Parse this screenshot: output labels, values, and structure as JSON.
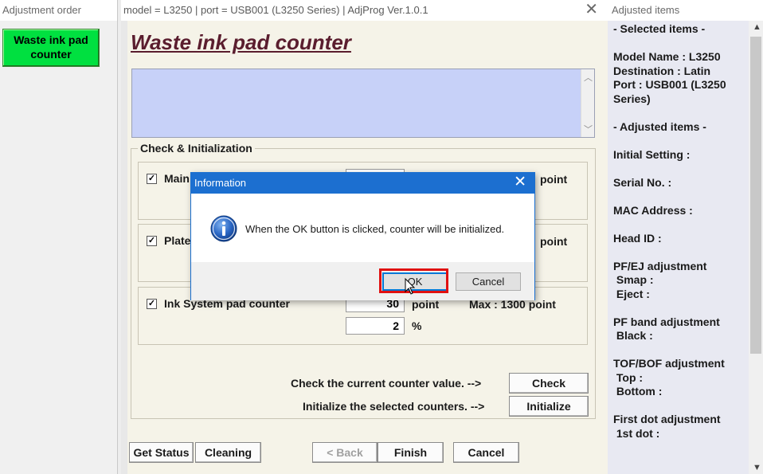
{
  "left_panel": {
    "title": "Adjustment order",
    "active_item": {
      "line1": "Waste ink pad",
      "line2": "counter",
      "color": "#00e040"
    }
  },
  "main_window": {
    "title": "model = L3250 | port = USB001 (L3250 Series) | AdjProg Ver.1.0.1",
    "heading": "Waste ink pad counter",
    "info_text": "",
    "group_title": "Check & Initialization",
    "counters": [
      {
        "checked": true,
        "name": "Main",
        "value": "",
        "unit": "point",
        "max": ""
      },
      {
        "checked": true,
        "name": "Plate",
        "value": "",
        "unit": "point",
        "max": ""
      },
      {
        "checked": true,
        "name": "Ink System pad counter",
        "value": "30",
        "unit": "point",
        "max": "Max : 1300 point",
        "percent": "2",
        "percent_unit": "%"
      }
    ],
    "check_hint": "Check the current counter value. -->",
    "check_button": "Check",
    "init_hint": "Initialize the selected counters. -->",
    "init_button": "Initialize",
    "footer_buttons": {
      "get_status": "Get Status",
      "cleaning": "Cleaning",
      "back": "< Back",
      "finish": "Finish",
      "cancel": "Cancel"
    }
  },
  "right_panel": {
    "title": "Adjusted items",
    "lines": [
      "- Selected items -",
      "",
      "Model Name : L3250",
      "Destination : Latin",
      "Port : USB001 (L3250",
      "Series)",
      "",
      "- Adjusted items -",
      "",
      "Initial Setting :",
      "",
      "Serial No. :",
      "",
      "MAC Address :",
      "",
      "Head ID :",
      "",
      "PF/EJ adjustment",
      " Smap :",
      " Eject :",
      "",
      "PF band adjustment",
      " Black :",
      "",
      "TOF/BOF adjustment",
      " Top :",
      " Bottom :",
      "",
      "First dot adjustment",
      " 1st dot :"
    ]
  },
  "dialog": {
    "title": "Information",
    "message": "When the OK button is clicked, counter will be initialized.",
    "ok_button": "OK",
    "cancel_button": "Cancel",
    "icon": "info-icon",
    "highlight_color": "#e01010"
  }
}
